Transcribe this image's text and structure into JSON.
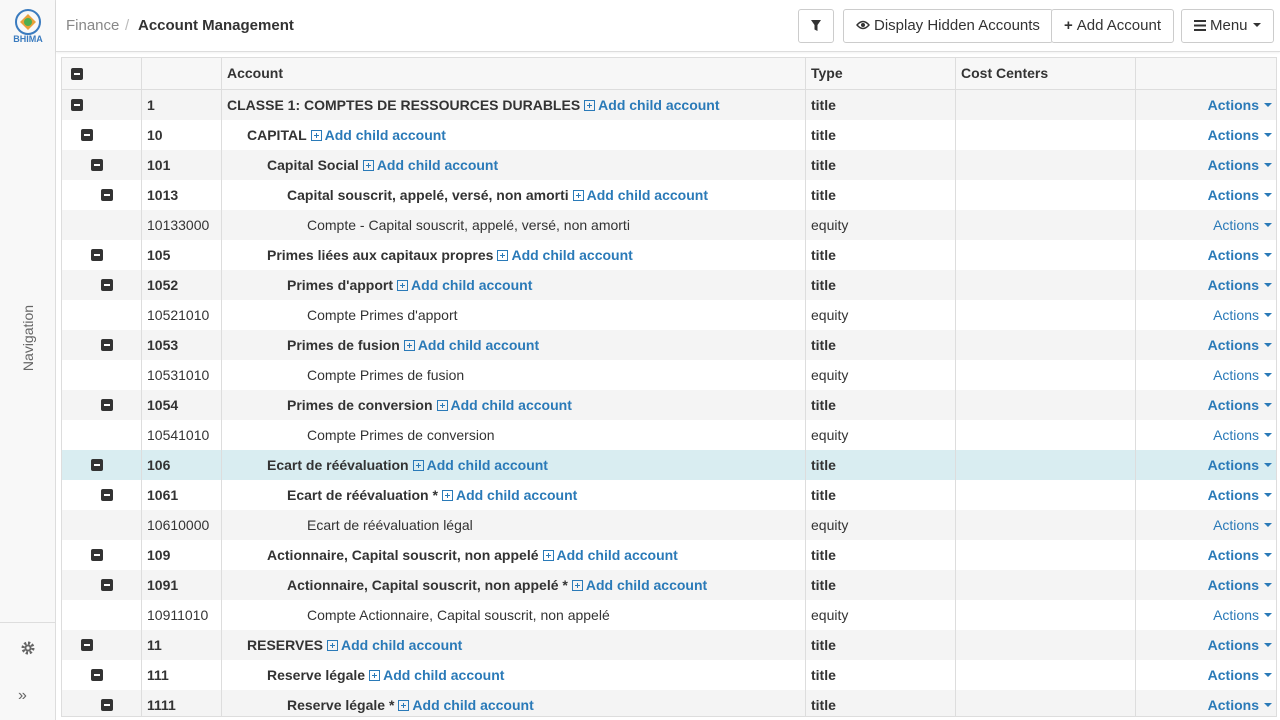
{
  "header": {
    "breadcrumb_root": "Finance",
    "breadcrumb_sep": "/",
    "breadcrumb_current": "Account Management",
    "btn_hidden": "Display Hidden Accounts",
    "btn_add": "Add Account",
    "btn_menu": "Menu"
  },
  "sidebar": {
    "label": "Navigation",
    "logo_text": "BHIMA"
  },
  "columns": {
    "account": "Account",
    "type": "Type",
    "cost_centers": "Cost Centers"
  },
  "add_child_label": "Add child account",
  "actions_label": "Actions",
  "rows": [
    {
      "number": "1",
      "label": "CLASSE 1: COMPTES DE RESSOURCES DURABLES",
      "type": "title",
      "is_title": true,
      "depth": 0
    },
    {
      "number": "10",
      "label": "CAPITAL",
      "type": "title",
      "is_title": true,
      "depth": 1
    },
    {
      "number": "101",
      "label": "Capital Social",
      "type": "title",
      "is_title": true,
      "depth": 2
    },
    {
      "number": "1013",
      "label": "Capital souscrit, appelé, versé, non amorti",
      "type": "title",
      "is_title": true,
      "depth": 3
    },
    {
      "number": "10133000",
      "label": "Compte - Capital souscrit, appelé, versé, non amorti",
      "type": "equity",
      "is_title": false,
      "depth": 4
    },
    {
      "number": "105",
      "label": "Primes liées aux capitaux propres",
      "type": "title",
      "is_title": true,
      "depth": 2
    },
    {
      "number": "1052",
      "label": "Primes d'apport",
      "type": "title",
      "is_title": true,
      "depth": 3
    },
    {
      "number": "10521010",
      "label": "Compte Primes d'apport",
      "type": "equity",
      "is_title": false,
      "depth": 4
    },
    {
      "number": "1053",
      "label": "Primes de fusion",
      "type": "title",
      "is_title": true,
      "depth": 3
    },
    {
      "number": "10531010",
      "label": "Compte Primes de fusion",
      "type": "equity",
      "is_title": false,
      "depth": 4
    },
    {
      "number": "1054",
      "label": "Primes de conversion",
      "type": "title",
      "is_title": true,
      "depth": 3
    },
    {
      "number": "10541010",
      "label": "Compte Primes de conversion",
      "type": "equity",
      "is_title": false,
      "depth": 4
    },
    {
      "number": "106",
      "label": "Ecart de réévaluation",
      "type": "title",
      "is_title": true,
      "depth": 2,
      "selected": true
    },
    {
      "number": "1061",
      "label": "Ecart de réévaluation *",
      "type": "title",
      "is_title": true,
      "depth": 3
    },
    {
      "number": "10610000",
      "label": "Ecart de réévaluation légal",
      "type": "equity",
      "is_title": false,
      "depth": 4
    },
    {
      "number": "109",
      "label": "Actionnaire, Capital souscrit, non appelé",
      "type": "title",
      "is_title": true,
      "depth": 2
    },
    {
      "number": "1091",
      "label": "Actionnaire, Capital souscrit, non appelé *",
      "type": "title",
      "is_title": true,
      "depth": 3
    },
    {
      "number": "10911010",
      "label": "Compte Actionnaire, Capital souscrit, non appelé",
      "type": "equity",
      "is_title": false,
      "depth": 4
    },
    {
      "number": "11",
      "label": "RESERVES",
      "type": "title",
      "is_title": true,
      "depth": 1
    },
    {
      "number": "111",
      "label": "Reserve légale",
      "type": "title",
      "is_title": true,
      "depth": 2
    },
    {
      "number": "1111",
      "label": "Reserve légale *",
      "type": "title",
      "is_title": true,
      "depth": 3
    }
  ]
}
